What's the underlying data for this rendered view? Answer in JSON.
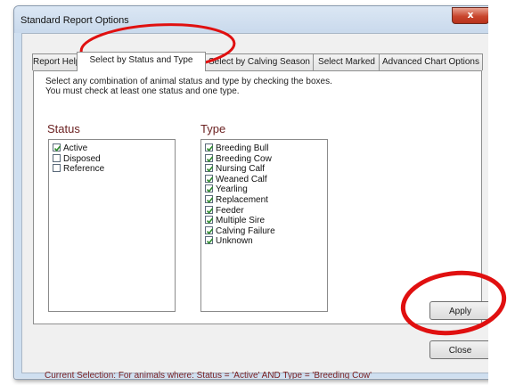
{
  "window": {
    "title": "Standard Report Options",
    "close_glyph": "x"
  },
  "tabs": [
    {
      "label": "Report Help",
      "active": false
    },
    {
      "label": "Select by Status and Type",
      "active": true
    },
    {
      "label": "Select by Calving Season",
      "active": false
    },
    {
      "label": "Select Marked",
      "active": false
    },
    {
      "label": "Advanced Chart Options",
      "active": false
    }
  ],
  "panel": {
    "instructions": "Select any combination of animal status and type by checking the boxes. You must check at least one status and one type.",
    "status_heading": "Status",
    "type_heading": "Type",
    "status_items": [
      {
        "label": "Active",
        "checked": true
      },
      {
        "label": "Disposed",
        "checked": false
      },
      {
        "label": "Reference",
        "checked": false
      }
    ],
    "type_items": [
      {
        "label": "Breeding Bull",
        "checked": true
      },
      {
        "label": "Breeding Cow",
        "checked": true
      },
      {
        "label": "Nursing Calf",
        "checked": true
      },
      {
        "label": "Weaned Calf",
        "checked": true
      },
      {
        "label": "Yearling",
        "checked": true
      },
      {
        "label": "Replacement",
        "checked": true
      },
      {
        "label": "Feeder",
        "checked": true
      },
      {
        "label": "Multiple Sire",
        "checked": true
      },
      {
        "label": "Calving Failure",
        "checked": true
      },
      {
        "label": "Unknown",
        "checked": true
      }
    ],
    "apply_label": "Apply"
  },
  "footer": {
    "current_selection": "Current Selection: For animals where:  Status = 'Active' AND Type = 'Breeding Cow'",
    "close_label": "Close"
  },
  "colors": {
    "annotation_red": "#e01010",
    "heading_maroon": "#6b2222",
    "check_green": "#2e8b2e"
  }
}
